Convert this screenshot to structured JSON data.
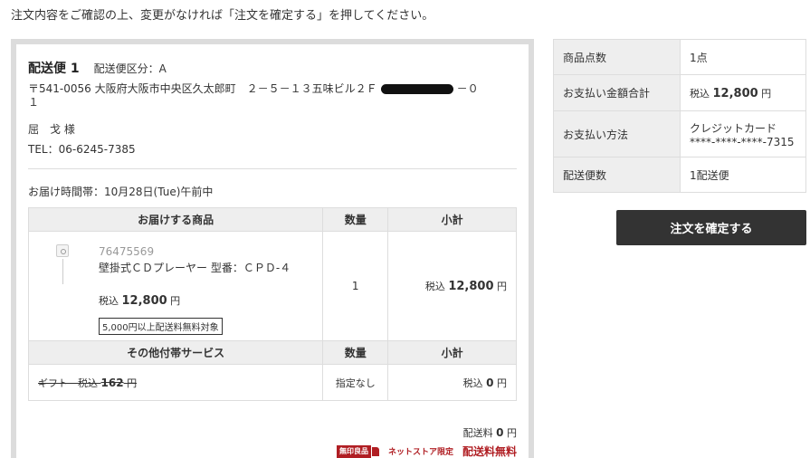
{
  "intro_text": "注文内容をご確認の上、変更がなければ「注文を確定する」を押してください。",
  "shipment": {
    "title": "配送便 1",
    "type": "配送便区分：A",
    "address_line1": "〒541-0056 大阪府大阪市中央区久太郎町　２－５－１３五味ビル２Ｆ",
    "address_tail": "－０",
    "address_line2": "１",
    "recipient": "屈　戈 様",
    "tel": "TEL：06-6245-7385",
    "delivery_time": "お届け時間帯：10月28日(Tue)午前中"
  },
  "items_table": {
    "headers": {
      "product": "お届けする商品",
      "qty": "数量",
      "subtotal": "小計"
    },
    "item": {
      "code": "76475569",
      "name": "壁掛式ＣＤプレーヤー 型番：ＣＰＤ-４",
      "price_prefix": "税込",
      "price": "12,800",
      "price_suffix": "円",
      "badge": "5,000円以上配送料無料対象",
      "qty": "1",
      "subtotal_prefix": "税込",
      "subtotal": "12,800",
      "subtotal_suffix": "円"
    },
    "service_headers": {
      "service": "その他付帯サービス",
      "qty": "数量",
      "subtotal": "小計"
    },
    "service": {
      "name": "ギフト",
      "price_prefix": "税込",
      "price": "162",
      "price_suffix": "円",
      "qty": "指定なし",
      "subtotal_prefix": "税込",
      "subtotal": "0",
      "subtotal_suffix": "円"
    }
  },
  "shipping_fee": {
    "label": "配送料",
    "value": "0",
    "suffix": "円"
  },
  "promo": {
    "logo_text": "無印良品",
    "net_only": "ネットストア限定",
    "free_shipping": "配送料無料"
  },
  "summary": {
    "rows": [
      {
        "label": "商品点数",
        "value": "1点"
      },
      {
        "label": "お支払い金額合計",
        "prefix": "税込",
        "value": "12,800",
        "suffix": "円"
      },
      {
        "label": "お支払い方法",
        "value": "クレジットカード",
        "value2": "****-****-****-7315"
      },
      {
        "label": "配送便数",
        "value": "1配送便"
      }
    ]
  },
  "confirm_button": "注文を確定する",
  "colors": {
    "accent_red": "#b01e23",
    "button_bg": "#333333",
    "header_bg": "#eeeeee"
  }
}
